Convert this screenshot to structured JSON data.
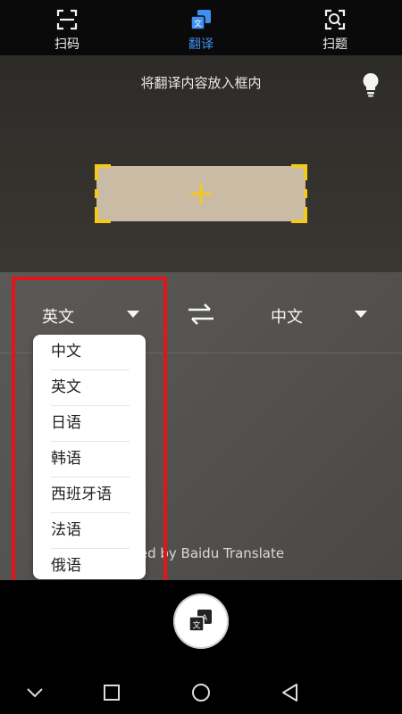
{
  "tabs": [
    {
      "label": "扫码",
      "icon": "scan-qr-icon",
      "active": false
    },
    {
      "label": "翻译",
      "icon": "translate-icon",
      "active": true
    },
    {
      "label": "扫题",
      "icon": "scan-question-icon",
      "active": false
    }
  ],
  "viewfinder": {
    "hint": "将翻译内容放入框内",
    "flash_icon": "lightbulb-icon"
  },
  "languages": {
    "source": "英文",
    "target": "中文",
    "swap_icon": "swap-arrows-icon"
  },
  "dropdown": {
    "options": [
      "中文",
      "英文",
      "日语",
      "韩语",
      "西班牙语",
      "法语",
      "俄语"
    ]
  },
  "powered_by": "red by Baidu Translate",
  "shutter_icon": "translate-capture-icon",
  "colors": {
    "accent": "#3d8ff0",
    "frame_corner": "#f3c920",
    "highlight": "#e4141b"
  },
  "system_nav": [
    "chevron-down-icon",
    "square-icon",
    "circle-icon",
    "triangle-back-icon"
  ]
}
